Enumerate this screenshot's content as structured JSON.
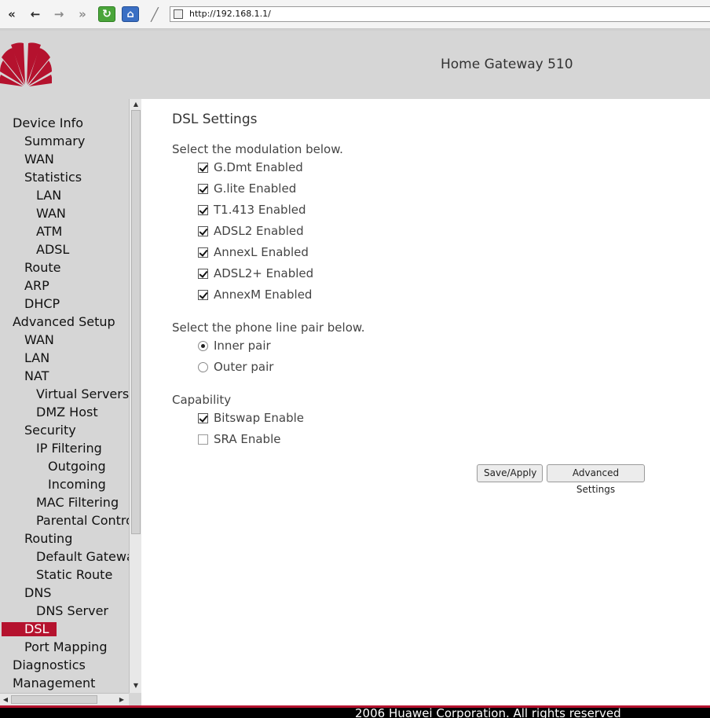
{
  "browser": {
    "url": "http://192.168.1.1/",
    "icons": [
      "first-page-icon",
      "back-icon",
      "forward-icon",
      "last-page-icon",
      "refresh-icon",
      "home-icon",
      "edit-icon",
      "page-icon"
    ]
  },
  "header": {
    "product_name": "Home Gateway 510",
    "logo": "huawei-logo",
    "accent_color": "#b5122e"
  },
  "sidebar": {
    "items": [
      {
        "label": "Device Info",
        "level": 0
      },
      {
        "label": "Summary",
        "level": 1
      },
      {
        "label": "WAN",
        "level": 1
      },
      {
        "label": "Statistics",
        "level": 1
      },
      {
        "label": "LAN",
        "level": 2
      },
      {
        "label": "WAN",
        "level": 2
      },
      {
        "label": "ATM",
        "level": 2
      },
      {
        "label": "ADSL",
        "level": 2
      },
      {
        "label": "Route",
        "level": 1
      },
      {
        "label": "ARP",
        "level": 1
      },
      {
        "label": "DHCP",
        "level": 1
      },
      {
        "label": "Advanced Setup",
        "level": 0
      },
      {
        "label": "WAN",
        "level": 1
      },
      {
        "label": "LAN",
        "level": 1
      },
      {
        "label": "NAT",
        "level": 1
      },
      {
        "label": "Virtual Servers",
        "level": 2
      },
      {
        "label": "DMZ Host",
        "level": 2
      },
      {
        "label": "Security",
        "level": 1
      },
      {
        "label": "IP Filtering",
        "level": 2
      },
      {
        "label": "Outgoing",
        "level": 3
      },
      {
        "label": "Incoming",
        "level": 3
      },
      {
        "label": "MAC Filtering",
        "level": 2
      },
      {
        "label": "Parental Control",
        "level": 2
      },
      {
        "label": "Routing",
        "level": 1
      },
      {
        "label": "Default Gateway",
        "level": 2
      },
      {
        "label": "Static Route",
        "level": 2
      },
      {
        "label": "DNS",
        "level": 1
      },
      {
        "label": "DNS Server",
        "level": 2
      },
      {
        "label": "DSL",
        "level": 1,
        "active": true
      },
      {
        "label": "Port Mapping",
        "level": 1
      },
      {
        "label": "Diagnostics",
        "level": 0
      },
      {
        "label": "Management",
        "level": 0
      }
    ]
  },
  "main": {
    "title": "DSL Settings",
    "modulation": {
      "label": "Select the modulation below.",
      "options": [
        {
          "label": "G.Dmt Enabled",
          "checked": true
        },
        {
          "label": "G.lite Enabled",
          "checked": true
        },
        {
          "label": "T1.413 Enabled",
          "checked": true
        },
        {
          "label": "ADSL2 Enabled",
          "checked": true
        },
        {
          "label": "AnnexL Enabled",
          "checked": true
        },
        {
          "label": "ADSL2+ Enabled",
          "checked": true
        },
        {
          "label": "AnnexM Enabled",
          "checked": true
        }
      ]
    },
    "phone_line": {
      "label": "Select the phone line pair below.",
      "options": [
        {
          "label": "Inner pair",
          "selected": true
        },
        {
          "label": "Outer pair",
          "selected": false
        }
      ]
    },
    "capability": {
      "label": "Capability",
      "options": [
        {
          "label": "Bitswap Enable",
          "checked": true
        },
        {
          "label": "SRA Enable",
          "checked": false
        }
      ]
    },
    "buttons": {
      "save_apply": "Save/Apply",
      "advanced": "Advanced Settings"
    }
  },
  "footer": {
    "text": "2006 Huawei Corporation. All rights reserved"
  }
}
